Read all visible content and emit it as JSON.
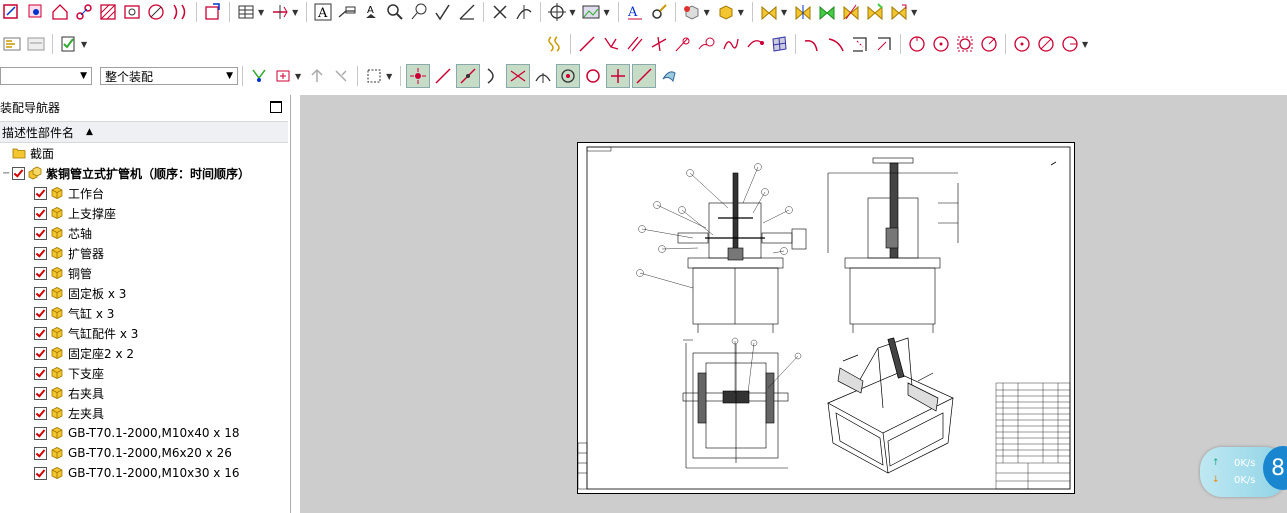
{
  "toolbar": {
    "assembly_filter_placeholder": "",
    "assembly_scope": "整个装配"
  },
  "navigator": {
    "title": "装配导航器",
    "column_header": "描述性部件名",
    "items": [
      {
        "label": "截面",
        "kind": "folder"
      },
      {
        "label": "紫铜管立式扩管机（顺序：时间顺序）",
        "kind": "root"
      },
      {
        "label": "工作台",
        "kind": "part"
      },
      {
        "label": "上支撑座",
        "kind": "part"
      },
      {
        "label": "芯轴",
        "kind": "part"
      },
      {
        "label": "扩管器",
        "kind": "part"
      },
      {
        "label": "铜管",
        "kind": "part"
      },
      {
        "label": "固定板 x 3",
        "kind": "part"
      },
      {
        "label": "气缸 x 3",
        "kind": "part"
      },
      {
        "label": "气缸配件 x 3",
        "kind": "part"
      },
      {
        "label": "固定座2 x 2",
        "kind": "part"
      },
      {
        "label": "下支座",
        "kind": "part"
      },
      {
        "label": "右夹具",
        "kind": "part"
      },
      {
        "label": "左夹具",
        "kind": "part"
      },
      {
        "label": "GB-T70.1-2000,M10x40 x 18",
        "kind": "part"
      },
      {
        "label": "GB-T70.1-2000,M6x20 x 26",
        "kind": "part"
      },
      {
        "label": "GB-T70.1-2000,M10x30 x 16",
        "kind": "part"
      }
    ]
  },
  "network": {
    "upload": "0K/s",
    "download": "0K/s",
    "ball_digit": "8"
  },
  "colors": {
    "graphics_bg": "#cdcdcd",
    "check_red": "#d10000",
    "cube_yellow": "#f3c530"
  }
}
